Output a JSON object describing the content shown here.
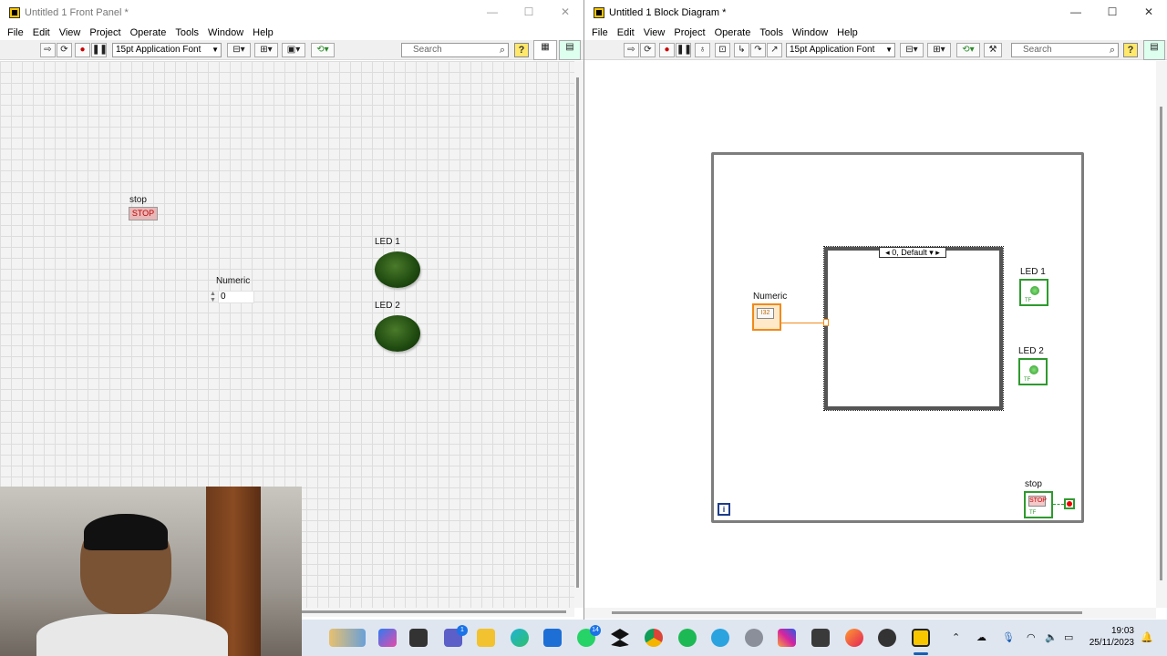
{
  "front_panel": {
    "title": "Untitled 1 Front Panel *",
    "menu": [
      "File",
      "Edit",
      "View",
      "Project",
      "Operate",
      "Tools",
      "Window",
      "Help"
    ],
    "font": "15pt Application Font",
    "search_placeholder": "Search",
    "controls": {
      "stop_label": "stop",
      "stop_button_text": "STOP",
      "numeric_label": "Numeric",
      "numeric_value": "0",
      "led1_label": "LED 1",
      "led2_label": "LED 2"
    }
  },
  "block_diagram": {
    "title": "Untitled 1 Block Diagram *",
    "menu": [
      "File",
      "Edit",
      "View",
      "Project",
      "Operate",
      "Tools",
      "Window",
      "Help"
    ],
    "font": "15pt Application Font",
    "search_placeholder": "Search",
    "case_selector": "0, Default",
    "iteration_terminal": "i",
    "terminals": {
      "numeric_label": "Numeric",
      "numeric_type": "I32",
      "led1_label": "LED 1",
      "led2_label": "LED 2",
      "stop_label": "stop",
      "stop_text": "STOP",
      "tf": "TF"
    }
  },
  "window_controls": {
    "minimize": "—",
    "maximize": "☐",
    "close": "✕"
  },
  "taskbar": {
    "badges": {
      "teams": "1",
      "whatsapp": "14"
    },
    "time": "19:03",
    "date": "25/11/2023"
  }
}
